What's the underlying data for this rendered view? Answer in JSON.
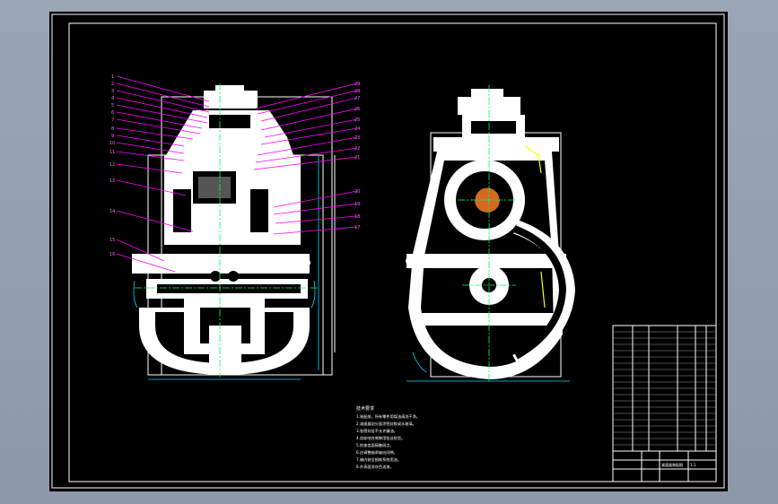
{
  "drawing": {
    "background": "#000000",
    "frame_color": "#ffffff",
    "leader_color": "#ff00ff",
    "centerline_color": "#00ff66",
    "dimension_color": "#00d8ff"
  },
  "left_view": {
    "part_labels_left": [
      "1",
      "2",
      "3",
      "4",
      "5",
      "6",
      "7",
      "8",
      "9",
      "10",
      "11",
      "12",
      "13",
      "14",
      "15",
      "16"
    ],
    "part_labels_right": [
      "29",
      "28",
      "27",
      "26",
      "25",
      "24",
      "23",
      "22",
      "21",
      "20",
      "19",
      "18",
      "17"
    ]
  },
  "tech_notes": {
    "title": "技术要求",
    "lines": [
      "1.装配前，所有零件用煤油清洗干净。",
      "2.减速器剖分面涂密封胶或水玻璃。",
      "3.各密封处不允许漏油。",
      "4.齿轮啮合侧隙用铅丝检验。",
      "5.检查齿面接触斑点。",
      "6.应调整轴承轴向间隙。",
      "7.箱内装全损耗系统用油。",
      "8.外表面涂灰色油漆。"
    ]
  },
  "title_block": {
    "drawing_name": "减速器装配图",
    "scale": "1:1"
  }
}
